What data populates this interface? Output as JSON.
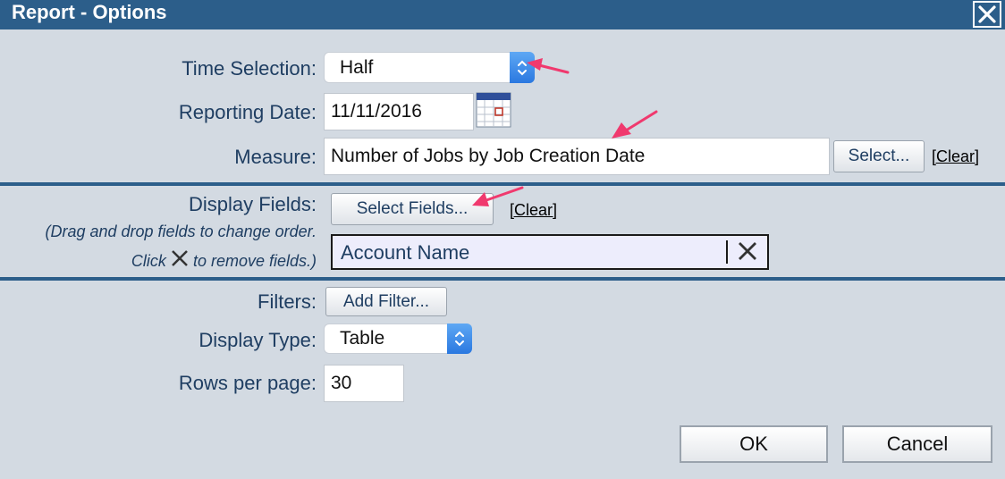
{
  "dialog": {
    "title": "Report - Options"
  },
  "time_selection": {
    "label": "Time Selection:",
    "value": "Half"
  },
  "reporting_date": {
    "label": "Reporting Date:",
    "value": "11/11/2016"
  },
  "measure": {
    "label": "Measure:",
    "value": "Number of Jobs by Job Creation Date",
    "select_label": "Select...",
    "clear_label": "[Clear]"
  },
  "display_fields": {
    "label": "Display Fields:",
    "help_line1": "(Drag and drop fields to change order.",
    "help_click": "Click",
    "help_line2_rest": "to remove fields.)",
    "select_label": "Select Fields...",
    "clear_label": "[Clear]",
    "fields": [
      "Account Name"
    ]
  },
  "filters": {
    "label": "Filters:",
    "add_label": "Add Filter..."
  },
  "display_type": {
    "label": "Display Type:",
    "value": "Table"
  },
  "rows_per_page": {
    "label": "Rows per page:",
    "value": "30"
  },
  "buttons": {
    "ok": "OK",
    "cancel": "Cancel"
  },
  "colors": {
    "titlebar": "#2c5e8a",
    "background": "#d3dae2",
    "label_text": "#1f3e62",
    "annotation_arrow": "#f0396e",
    "select_accent": "#3a86ea"
  },
  "icons": {
    "close": "close-icon",
    "calendar": "calendar-icon",
    "remove": "remove-x-icon",
    "updown": "updown-chevron-icon"
  }
}
